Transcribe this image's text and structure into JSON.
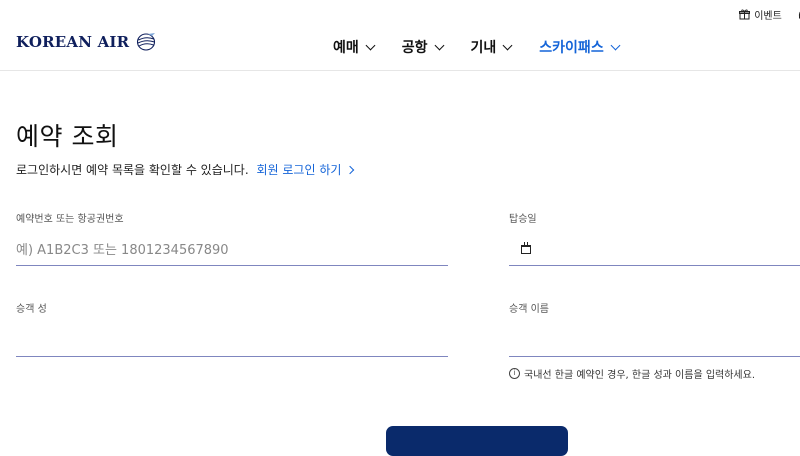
{
  "utility": {
    "event_label": "이벤트",
    "support_label": "고"
  },
  "header": {
    "logo_text": "KOREAN AIR",
    "nav": [
      {
        "label": "예매"
      },
      {
        "label": "공항"
      },
      {
        "label": "기내"
      },
      {
        "label": "스카이패스"
      }
    ]
  },
  "page": {
    "title": "예약 조회",
    "subtitle": "로그인하시면 예약 목록을 확인할 수 있습니다.",
    "login_link": "회원 로그인 하기"
  },
  "form": {
    "booking_label": "예약번호 또는 항공권번호",
    "booking_placeholder": "예) A1B2C3 또는 1801234567890",
    "date_label": "탑승일",
    "last_name_label": "승객 성",
    "first_name_label": "승객 이름",
    "hint": "국내선 한글 예약인 경우, 한글 성과 이름을 입력하세요.",
    "submit_label": ""
  },
  "colors": {
    "accent": "#1464d8",
    "brand_navy": "#0a2a6b",
    "input_underline": "#7f86bf"
  }
}
